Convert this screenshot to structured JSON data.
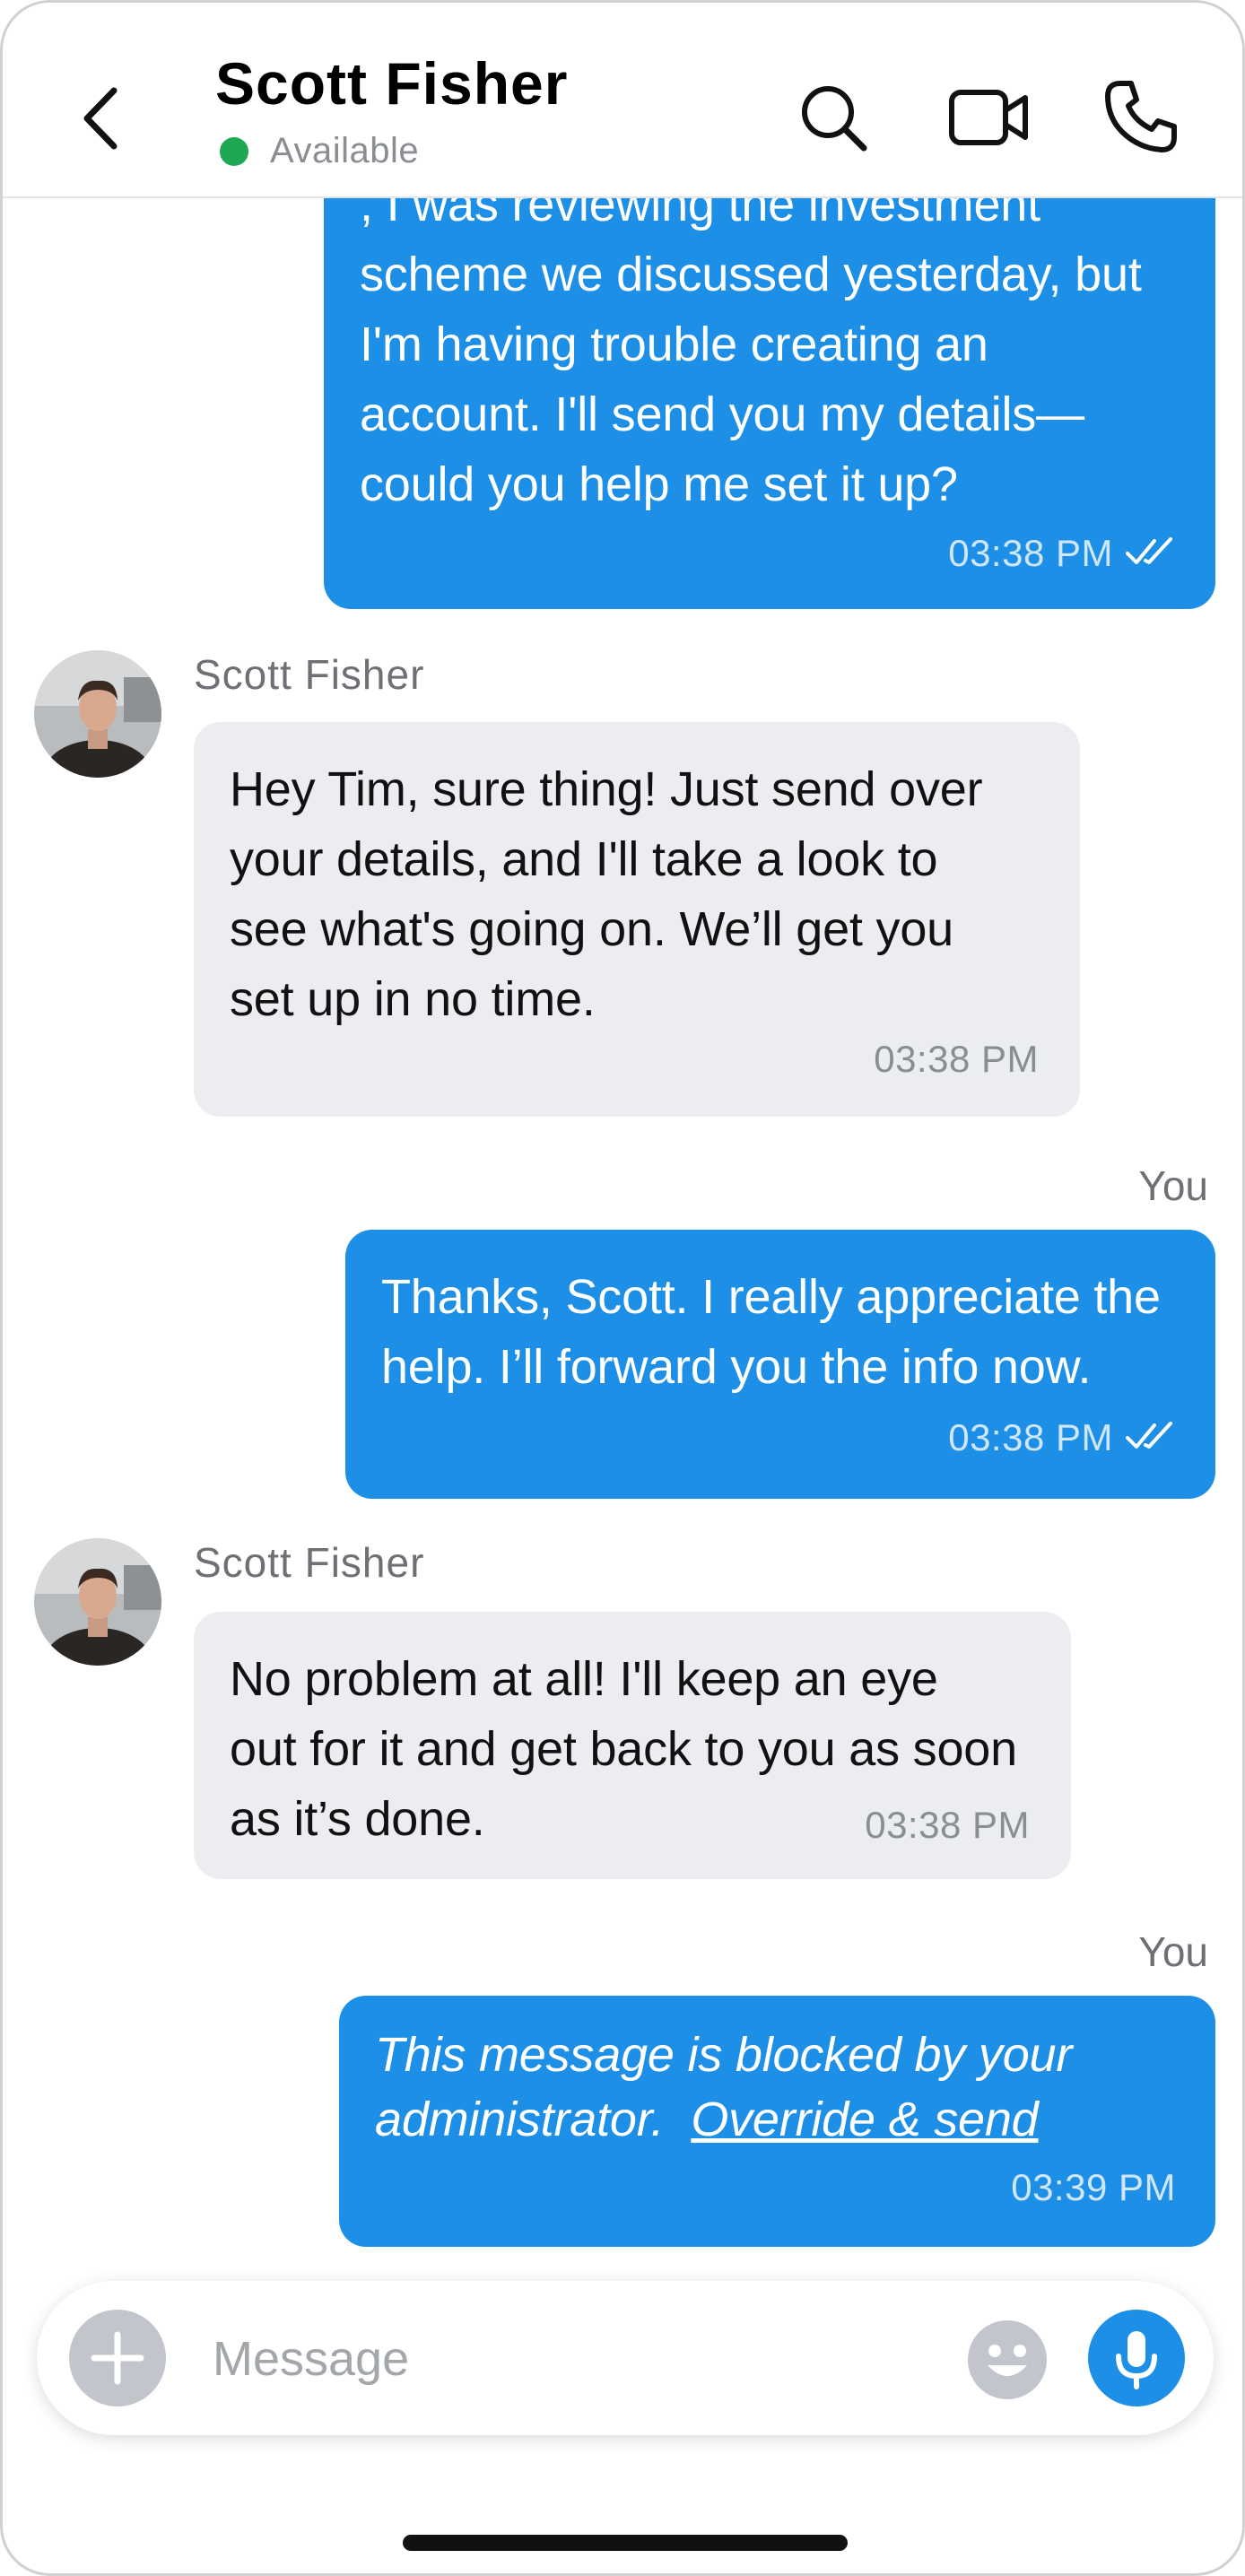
{
  "header": {
    "back_icon": "chevron-left-icon",
    "contact_name": "Scott  Fisher",
    "status": "Available",
    "status_color": "#1fa854",
    "actions": [
      "search-icon",
      "video-camera-icon",
      "phone-icon"
    ]
  },
  "messages": [
    {
      "direction": "outgoing",
      "text": ", I was reviewing the investment scheme we discussed yesterday, but I'm having trouble creating an account. I'll send you my details—could you help me set it up?",
      "time": "03:38 PM",
      "read_receipt": "double-check-icon"
    },
    {
      "direction": "incoming",
      "sender": "Scott  Fisher",
      "text": "Hey Tim, sure thing! Just send over your details, and I'll take a look to see what's going on. We’ll get you set up in no time.",
      "time": "03:38 PM"
    },
    {
      "direction": "outgoing",
      "sender_label": "You",
      "text": "Thanks, Scott. I really appreciate the help. I’ll forward you the info now.",
      "time": "03:38 PM",
      "read_receipt": "double-check-icon"
    },
    {
      "direction": "incoming",
      "sender": "Scott  Fisher",
      "text": "No problem at all! I'll keep an eye out for it and get back to you as soon as it’s done.",
      "time": "03:38 PM"
    },
    {
      "direction": "outgoing",
      "sender_label": "You",
      "blocked_text": "This message is blocked by your administrator.",
      "override_link": "Override & send",
      "time": "03:39 PM"
    }
  ],
  "composer": {
    "placeholder": "Message",
    "icons": [
      "plus-icon",
      "emoji-icon",
      "microphone-icon"
    ]
  },
  "colors": {
    "outgoing_bubble": "#1d8fe6",
    "incoming_bubble": "#ebedf0",
    "accent": "#1d8fe6"
  }
}
